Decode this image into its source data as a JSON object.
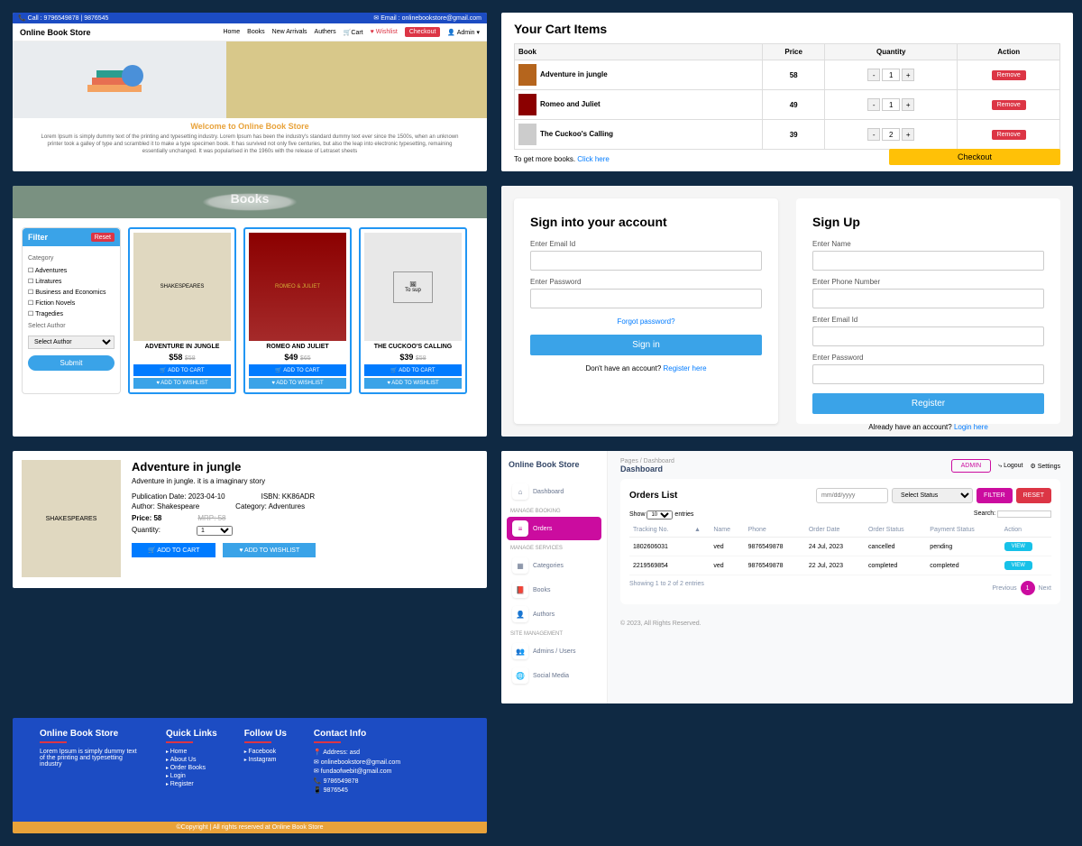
{
  "p1": {
    "call": "📞 Call : 9796549878 | 9876545",
    "email": "✉ Email : onlinebookstore@gmail.com",
    "brand": "Online Book Store",
    "nav": {
      "home": "Home",
      "books": "Books",
      "newarrivals": "New Arrivals",
      "authors": "Authers",
      "cart": "🛒Cart",
      "wishlist": "♥ Wishlist",
      "checkout": "Checkout",
      "admin": "👤 Admin ▾"
    },
    "welcome": "Welcome to Online Book Store",
    "lorem": "Lorem Ipsum is simply dummy text of the printing and typesetting industry. Lorem Ipsum has been the industry's standard dummy text ever since the 1500s, when an unknown printer took a galley of type and scrambled it to make a type specimen book. It has survived not only five centuries, but also the leap into electronic typesetting, remaining essentially unchanged. It was popularised in the 1960s with the release of Letraset sheets"
  },
  "p2": {
    "heading": "Your Cart Items",
    "cols": {
      "book": "Book",
      "price": "Price",
      "qty": "Quantity",
      "action": "Action"
    },
    "rows": [
      {
        "title": "Adventure in jungle",
        "price": "58",
        "qty": "1"
      },
      {
        "title": "Romeo and Juliet",
        "price": "49",
        "qty": "1"
      },
      {
        "title": "The Cuckoo's Calling",
        "price": "39",
        "qty": "2"
      }
    ],
    "remove": "Remove",
    "more": "To get more books. ",
    "click": "Click here",
    "checkout": "Checkout"
  },
  "p3": {
    "heading": "Books",
    "filter": "Filter",
    "reset": "Reset",
    "catlbl": "Category",
    "cats": [
      "Adventures",
      "Litratures",
      "Business and Economics",
      "Fiction Novels",
      "Tragedies"
    ],
    "authlbl": "Select Author",
    "authsel": "Select Author",
    "submit": "Submit",
    "books": [
      {
        "title": "ADVENTURE IN JUNGLE",
        "price": "$58",
        "old": "$58",
        "cover": "SHAKESPEARES"
      },
      {
        "title": "ROMEO AND JULIET",
        "price": "$49",
        "old": "$65",
        "cover": "ROMEO & JULIET"
      },
      {
        "title": "THE CUCKOO'S CALLING",
        "price": "$39",
        "old": "$58",
        "cover": "To sup"
      }
    ],
    "addcart": "🛒  ADD TO CART",
    "addwish": "♥   ADD TO WISHLIST"
  },
  "p4": {
    "signin": {
      "h": "Sign into your account",
      "email": "Enter Email Id",
      "pass": "Enter Password",
      "forgot": "Forgot password?",
      "btn": "Sign in",
      "noacc": "Don't have an account? ",
      "reg": "Register here"
    },
    "signup": {
      "h": "Sign Up",
      "name": "Enter Name",
      "phone": "Enter Phone Number",
      "email": "Enter Email Id",
      "pass": "Enter Password",
      "btn": "Register",
      "have": "Already have an account? ",
      "login": "Login here"
    }
  },
  "p5": {
    "title": "Adventure in jungle",
    "desc": "Adventure in jungle. it is a imaginary story",
    "pubdate": "Publication Date: 2023-04-10",
    "isbn": "ISBN: KK86ADR",
    "author": "Author: Shakespeare",
    "category": "Category: Adventures",
    "pricelbl": "Price: 58",
    "mrp": "MRP: 58",
    "qtylbl": "Quantity:",
    "qty": "1",
    "add": "🛒  ADD TO CART",
    "wish": "♥   ADD TO WISHLIST"
  },
  "p6": {
    "brand": "Online Book Store",
    "crumb": "Pages / Dashboard",
    "title": "Dashboard",
    "admin": "ADMIN",
    "logout": "⤷ Logout",
    "settings": "⚙ Settings",
    "side": {
      "dash": "Dashboard",
      "s1": "MANAGE BOOKING",
      "orders": "Orders",
      "s2": "MANAGE SERVICES",
      "cat": "Categories",
      "books": "Books",
      "auth": "Authors",
      "s3": "SITE MANAGEMENT",
      "admins": "Admins / Users",
      "social": "Social Media"
    },
    "orderslist": "Orders List",
    "date": "mm/dd/yyyy",
    "status": "Select Status",
    "filter": "FILTER",
    "reset": "RESET",
    "show": "Show",
    "entries": "entries",
    "search": "Search:",
    "cols": {
      "t": "Tracking No.",
      "n": "Name",
      "p": "Phone",
      "d": "Order Date",
      "os": "Order Status",
      "ps": "Payment Status",
      "a": "Action"
    },
    "rows": [
      {
        "t": "1802606031",
        "n": "ved",
        "p": "9876549878",
        "d": "24 Jul, 2023",
        "os": "cancelled",
        "ps": "pending"
      },
      {
        "t": "2219569854",
        "n": "ved",
        "p": "9876549878",
        "d": "22 Jul, 2023",
        "os": "completed",
        "ps": "completed"
      }
    ],
    "view": "VIEW",
    "showing": "Showing 1 to 2 of 2 entries",
    "prev": "Previous",
    "pg": "1",
    "next": "Next",
    "copy": "© 2023, All Rights Reserved."
  },
  "p7": {
    "c1h": "Online Book Store",
    "c1t": "Lorem Ipsum is simply dummy text of the printing and typesetting industry",
    "c2h": "Quick Links",
    "c2": [
      "Home",
      "About Us",
      "Order Books",
      "Login",
      "Register"
    ],
    "c3h": "Follow Us",
    "c3": [
      "Facebook",
      "Instagram"
    ],
    "c4h": "Contact Info",
    "c4": [
      "📍 Address: asd",
      "✉ onlinebookstore@gmail.com",
      "✉ fundaofwebit@gmail.com",
      "📞 9786549878",
      "📱 9876545"
    ],
    "copy": "©Copyright | All rights reserved at Online Book Store"
  }
}
